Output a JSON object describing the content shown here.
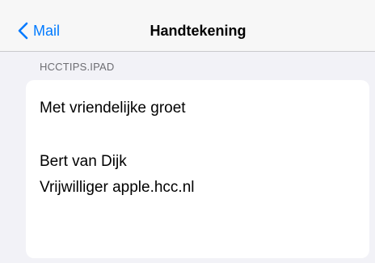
{
  "navbar": {
    "back_label": "Mail",
    "title": "Handtekening",
    "back_icon": "chevron-left-icon",
    "accent_color": "#007aff"
  },
  "section": {
    "header": "HCCTIPS.IPAD"
  },
  "signature": {
    "lines": [
      "Met vriendelijke groet",
      "",
      "Bert van Dijk",
      "Vrijwilliger apple.hcc.nl"
    ]
  }
}
